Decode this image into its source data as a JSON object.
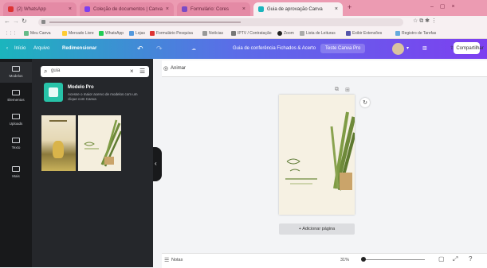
{
  "browser": {
    "tabs": [
      {
        "label": "(2) WhatsApp"
      },
      {
        "label": "Coleção de documentos | Canva"
      },
      {
        "label": "Formulário: Cores"
      },
      {
        "label": "Guia de aprovação Canva"
      }
    ],
    "bookmarks": [
      {
        "label": "Meu Canva"
      },
      {
        "label": "Mercado Livre"
      },
      {
        "label": "WhatsApp"
      },
      {
        "label": "Lojas"
      },
      {
        "label": "Formulário Pesquisa"
      },
      {
        "label": "Notícias"
      },
      {
        "label": "IPTV / Contratação"
      },
      {
        "label": "Zoom"
      },
      {
        "label": "Lista de Leituras"
      },
      {
        "label": "Exibir Extensões"
      },
      {
        "label": "Registro de Tarefas"
      }
    ]
  },
  "header": {
    "home": "Início",
    "file": "Arquivo",
    "resize": "Redimensionar",
    "undo_icon": "undo-icon",
    "redo_icon": "redo-icon",
    "doc_title": "Guia de conferência Fichados & Acerto",
    "pro_button": "Teste Canva Pro",
    "share": "Compartilhar"
  },
  "rail": [
    {
      "label": "Modelos",
      "icon": "templates-icon"
    },
    {
      "label": "Elementos",
      "icon": "elements-icon"
    },
    {
      "label": "Uploads",
      "icon": "upload-icon"
    },
    {
      "label": "Texto",
      "icon": "text-icon"
    },
    {
      "label": "Mais",
      "icon": "more-icon"
    }
  ],
  "panel": {
    "search_value": "guia",
    "result_title": "Modelo Pro",
    "result_desc": "Acesse o maior acervo de modelos com um clique com Canva"
  },
  "canvas": {
    "edit_label": "Animar",
    "add_page": "+ Adicionar página",
    "notes": "Notas",
    "zoom": "31%"
  },
  "colors": {
    "accent_start": "#1bb5bd",
    "accent_end": "#7d3ff0",
    "tab_bg": "#ec9bb2"
  }
}
